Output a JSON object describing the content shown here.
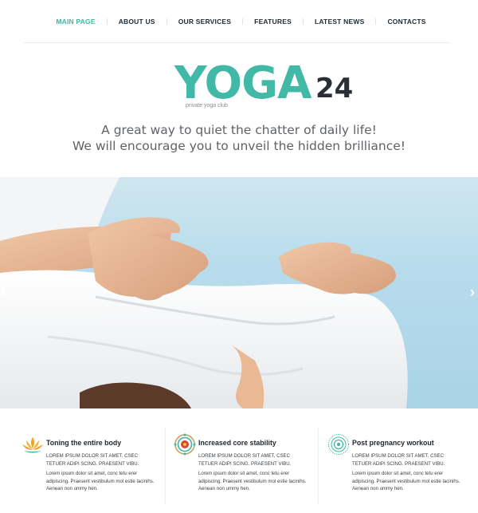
{
  "nav": {
    "items": [
      {
        "label": "MAIN PAGE",
        "active": true
      },
      {
        "label": "ABOUT US",
        "active": false
      },
      {
        "label": "OUR SERVICES",
        "active": false
      },
      {
        "label": "FEATURES",
        "active": false
      },
      {
        "label": "LATEST NEWS",
        "active": false
      },
      {
        "label": "CONTACTS",
        "active": false
      }
    ]
  },
  "logo": {
    "word": "YOGA",
    "number": "24",
    "tagline": "private yoga club"
  },
  "tagline": {
    "line1": "A great way to quiet the chatter of daily life!",
    "line2": "We will encourage you to unveil the hidden brilliance!"
  },
  "slider": {
    "prev_icon": "chevron-left-icon",
    "next_icon": "chevron-right-icon",
    "prev_symbol": "‹",
    "next_symbol": "›"
  },
  "features": [
    {
      "icon": "lotus-icon",
      "title": "Toning the  entire body",
      "text1": "LOREM IPSUM DOLOR SIT AMET, CSEC TETUER ADIPI SCING. PRAESENT VIBU.",
      "text2": "Lorem ipsum dolor sit amet, conc tetu erer adipiscing. Praesent vestibulum mol estie lacinihs. Aenean non ummy hen."
    },
    {
      "icon": "mandala-icon",
      "title": "Increased core  stability",
      "text1": "LOREM IPSUM DOLOR SIT AMET, CSEC TETUER ADIPI SCING. PRAESENT VIBU.",
      "text2": "Lorem ipsum dolor sit amet, conc tetu erer adipiscing. Praesent vestibulum mol estie lacinihs. Aenean non ummy hen."
    },
    {
      "icon": "sun-circle-icon",
      "title": "Post pregnancy workout",
      "text1": "LOREM IPSUM DOLOR SIT AMET, CSEC TETUER ADIPI SCING. PRAESENT VIBU.",
      "text2": "Lorem ipsum dolor sit amet, conc tetu erer adipiscing. Praesent vestibulum mol estie lacinihs. Aenean non ummy hen."
    }
  ],
  "colors": {
    "accent": "#41b9a6",
    "dark": "#2a2f36",
    "sky": "#b7dcec"
  }
}
